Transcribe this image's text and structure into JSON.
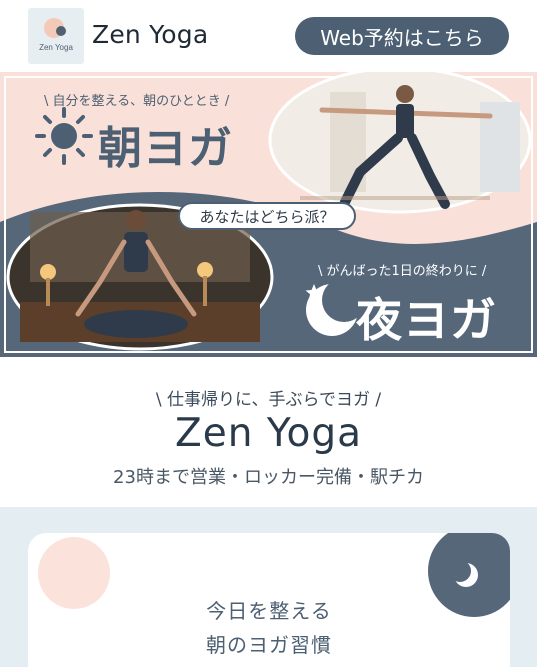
{
  "header": {
    "logo_text": "Zen Yoga",
    "brand": "Zen Yoga",
    "reserve_label": "Web予約はこちら"
  },
  "hero": {
    "morning_sub": "\\ 自分を整える、朝のひととき /",
    "morning_title": "朝ヨガ",
    "night_sub": "\\ がんばった1日の終わりに /",
    "night_title": "夜ヨガ",
    "question": "あなたはどちら派？"
  },
  "intro": {
    "tagline": "\\ 仕事帰りに、手ぶらでヨガ /",
    "title": "Zen Yoga",
    "info": "23時まで営業・ロッカー完備・駅チカ"
  },
  "card": {
    "line1": "今日を整える",
    "line2": "朝のヨガ習慣"
  },
  "colors": {
    "accent_navy": "#4d5f72",
    "peach": "#fbe3dc",
    "light_blue_bg": "#e4edf2"
  }
}
